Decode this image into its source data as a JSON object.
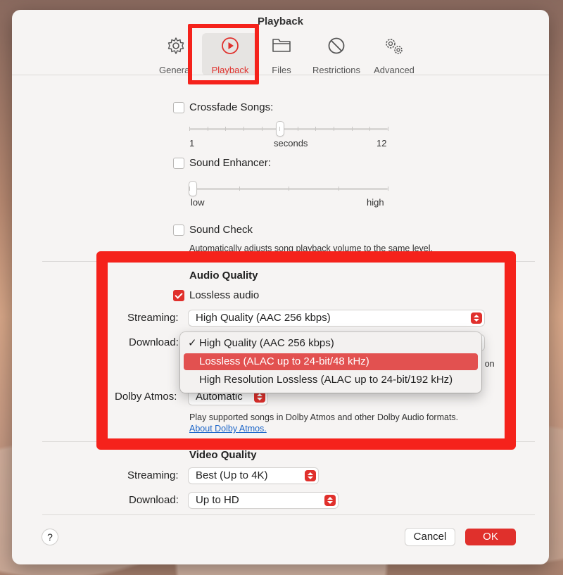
{
  "window": {
    "title": "Playback"
  },
  "toolbar": {
    "items": [
      {
        "label": "General",
        "icon": "gear-icon"
      },
      {
        "label": "Playback",
        "icon": "play-circle-icon"
      },
      {
        "label": "Files",
        "icon": "folder-icon"
      },
      {
        "label": "Restrictions",
        "icon": "prohibited-icon"
      },
      {
        "label": "Advanced",
        "icon": "gears-icon"
      }
    ],
    "active": "Playback"
  },
  "playback": {
    "crossfade": {
      "label": "Crossfade Songs:",
      "checked": false,
      "min_label": "1",
      "mid_label": "seconds",
      "max_label": "12",
      "level": 0.45
    },
    "enhancer": {
      "label": "Sound Enhancer:",
      "checked": false,
      "low_label": "low",
      "high_label": "high",
      "level": 0.0
    },
    "sound_check": {
      "label": "Sound Check",
      "checked": false,
      "description": "Automatically adjusts song playback volume to the same level."
    }
  },
  "audio_quality": {
    "heading": "Audio Quality",
    "lossless": {
      "label": "Lossless audio",
      "checked": true
    },
    "streaming_label": "Streaming:",
    "streaming_value": "High Quality (AAC 256 kbps)",
    "download_label": "Download:",
    "dropdown_options": [
      "High Quality (AAC 256 kbps)",
      "Lossless (ALAC up to 24-bit/48 kHz)",
      "High Resolution Lossless (ALAC up to 24-bit/192 kHz)"
    ],
    "dropdown_checked_index": 0,
    "dropdown_highlight_index": 1,
    "hidden_desc_tail": "s on",
    "dolby_label": "Dolby Atmos:",
    "dolby_value": "Automatic",
    "dolby_desc": "Play supported songs in Dolby Atmos and other Dolby Audio formats.",
    "dolby_link": "About Dolby Atmos."
  },
  "video_quality": {
    "heading": "Video Quality",
    "streaming_label": "Streaming:",
    "streaming_value": "Best (Up to 4K)",
    "download_label": "Download:",
    "download_value": "Up to HD"
  },
  "footer": {
    "help_label": "?",
    "cancel_label": "Cancel",
    "ok_label": "OK"
  },
  "colors": {
    "accent": "#e0302c",
    "highlight_box": "#f5221b",
    "menu_selection": "#e25150"
  }
}
